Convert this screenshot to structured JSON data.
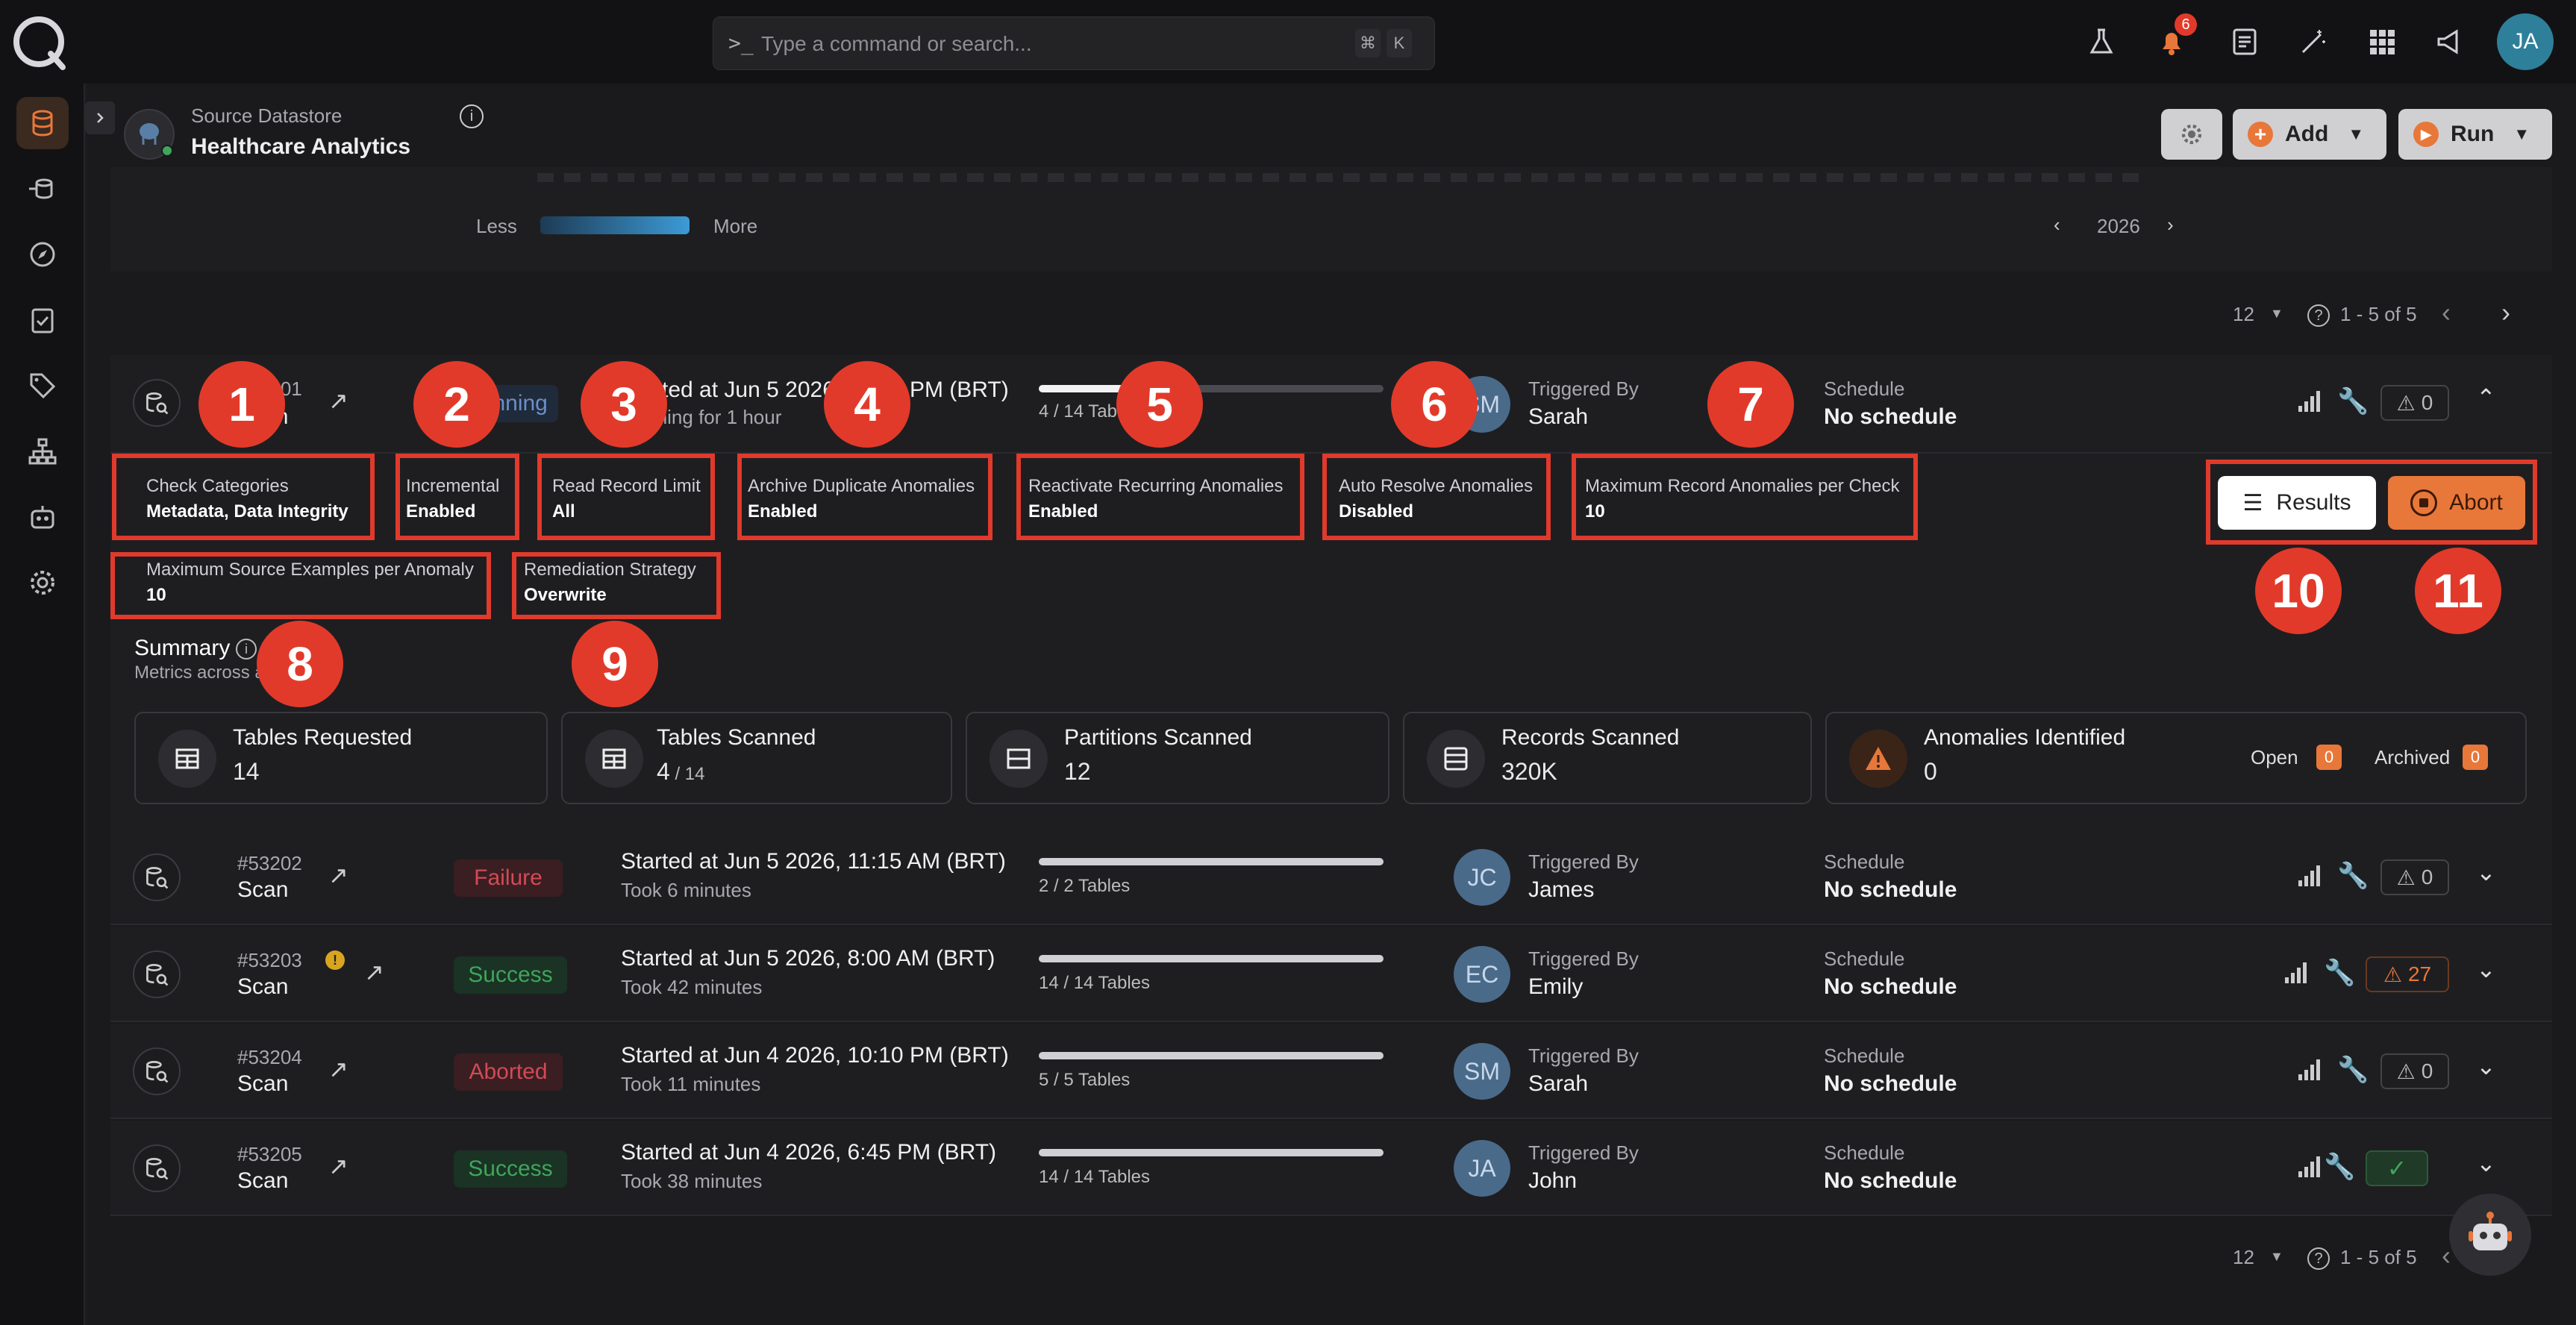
{
  "search": {
    "placeholder": "Type a command or search...",
    "shortcut_cmd": "⌘",
    "shortcut_key": "K"
  },
  "header_icons": {
    "notifications_count": "6",
    "user_initials": "JA"
  },
  "datastore": {
    "label": "Source Datastore",
    "name": "Healthcare Analytics"
  },
  "actions": {
    "add_label": "Add",
    "run_label": "Run"
  },
  "heatmap": {
    "less_label": "Less",
    "more_label": "More",
    "year": "2026"
  },
  "pagination": {
    "per_page": "12",
    "range": "1 - 5 of 5"
  },
  "expanded_row": {
    "id": "#53201",
    "type": "Scan",
    "status": "Running",
    "started": "Started at Jun 5 2026, 12:03 PM (BRT)",
    "duration": "Running for 1 hour",
    "progress_text": "4 / 14 Tables",
    "progress_fraction": 0.29,
    "avatar": "SM",
    "triggered_label": "Triggered By",
    "triggered_by": "Sarah",
    "schedule_label": "Schedule",
    "schedule": "No schedule",
    "anomalies": "0"
  },
  "settings": [
    {
      "label": "Check Categories",
      "value": "Metadata, Data Integrity"
    },
    {
      "label": "Incremental",
      "value": "Enabled"
    },
    {
      "label": "Read Record Limit",
      "value": "All"
    },
    {
      "label": "Archive Duplicate Anomalies",
      "value": "Enabled"
    },
    {
      "label": "Reactivate Recurring Anomalies",
      "value": "Enabled"
    },
    {
      "label": "Auto Resolve Anomalies",
      "value": "Disabled"
    },
    {
      "label": "Maximum Record Anomalies per Check",
      "value": "10"
    },
    {
      "label": "Maximum Source Examples per Anomaly",
      "value": "10"
    },
    {
      "label": "Remediation Strategy",
      "value": "Overwrite"
    }
  ],
  "buttons": {
    "results": "Results",
    "abort": "Abort"
  },
  "callouts": [
    "1",
    "2",
    "3",
    "4",
    "5",
    "6",
    "7",
    "8",
    "9",
    "10",
    "11"
  ],
  "summary": {
    "title": "Summary",
    "subtitle": "Metrics across all",
    "cards": [
      {
        "label": "Tables Requested",
        "value": "14",
        "suffix": ""
      },
      {
        "label": "Tables Scanned",
        "value": "4",
        "suffix": " / 14"
      },
      {
        "label": "Partitions Scanned",
        "value": "12",
        "suffix": ""
      },
      {
        "label": "Records Scanned",
        "value": "320K",
        "suffix": ""
      }
    ],
    "anomalies": {
      "label": "Anomalies Identified",
      "value": "0",
      "open_label": "Open",
      "open": "0",
      "archived_label": "Archived",
      "archived": "0"
    }
  },
  "rows": [
    {
      "id": "#53202",
      "type": "Scan",
      "status": "Failure",
      "started": "Started at Jun 5 2026, 11:15 AM (BRT)",
      "duration": "Took 6 minutes",
      "progress_text": "2 / 2 Tables",
      "avatar": "JC",
      "triggered_label": "Triggered By",
      "triggered_by": "James",
      "schedule_label": "Schedule",
      "schedule": "No schedule",
      "anomalies": "0"
    },
    {
      "id": "#53203",
      "type": "Scan",
      "status": "Success",
      "started": "Started at Jun 5 2026, 8:00 AM (BRT)",
      "duration": "Took 42 minutes",
      "progress_text": "14 / 14 Tables",
      "avatar": "EC",
      "triggered_label": "Triggered By",
      "triggered_by": "Emily",
      "schedule_label": "Schedule",
      "schedule": "No schedule",
      "anomalies": "27"
    },
    {
      "id": "#53204",
      "type": "Scan",
      "status": "Aborted",
      "started": "Started at Jun 4 2026, 10:10 PM (BRT)",
      "duration": "Took 11 minutes",
      "progress_text": "5 / 5 Tables",
      "avatar": "SM",
      "triggered_label": "Triggered By",
      "triggered_by": "Sarah",
      "schedule_label": "Schedule",
      "schedule": "No schedule",
      "anomalies": "0"
    },
    {
      "id": "#53205",
      "type": "Scan",
      "status": "Success",
      "started": "Started at Jun 4 2026, 6:45 PM (BRT)",
      "duration": "Took 38 minutes",
      "progress_text": "14 / 14 Tables",
      "avatar": "JA",
      "triggered_label": "Triggered By",
      "triggered_by": "John",
      "schedule_label": "Schedule",
      "schedule": "No schedule",
      "anomalies": ""
    }
  ],
  "colors": {
    "accent": "#e8773a",
    "danger": "#e23a2a",
    "success": "#3fa55b",
    "failure": "#d24a55"
  }
}
